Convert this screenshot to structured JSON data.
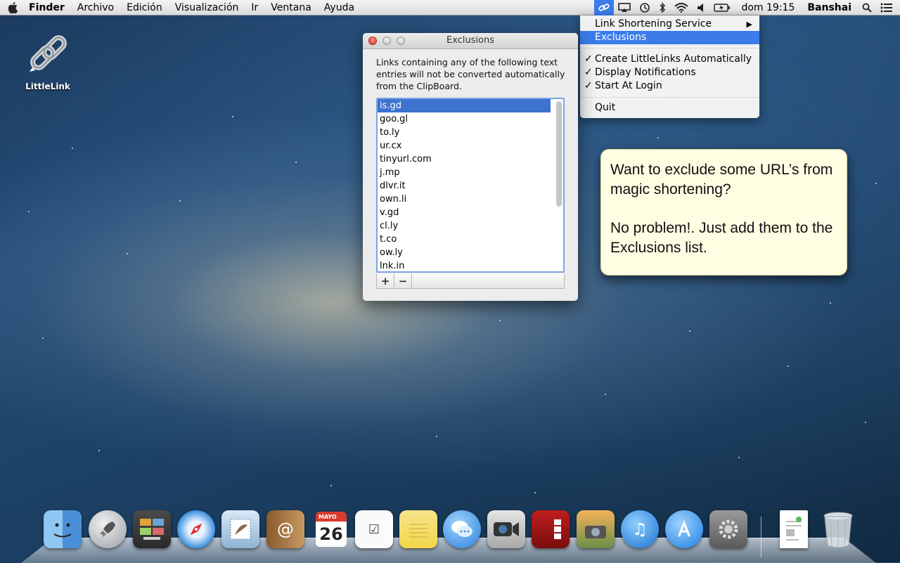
{
  "menubar": {
    "apple_icon": "apple-icon",
    "app_name": "Finder",
    "menus": [
      "Archivo",
      "Edición",
      "Visualización",
      "Ir",
      "Ventana",
      "Ayuda"
    ],
    "clock": "dom 19:15",
    "user": "Banshai",
    "status_icons": [
      "littlelink-icon",
      "airplay-icon",
      "time-machine-icon",
      "bluetooth-icon",
      "wifi-icon",
      "volume-icon",
      "battery-icon",
      "spotlight-icon",
      "notification-center-icon"
    ]
  },
  "status_menu": {
    "items": [
      {
        "label": "Link Shortening Service",
        "submenu": true
      },
      {
        "label": "Exclusions",
        "highlighted": true
      },
      {
        "label": "Create LittleLinks Automatically",
        "checked": true
      },
      {
        "label": "Display Notifications",
        "checked": true
      },
      {
        "label": "Start At Login",
        "checked": true
      },
      {
        "label": "Quit"
      }
    ],
    "check_glyph": "✓",
    "arrow_glyph": "▶"
  },
  "desktop": {
    "icon_label": "LittleLink"
  },
  "window": {
    "title": "Exclusions",
    "description": "Links containing any of the following text entries will not be converted automatically from the ClipBoard.",
    "entries": [
      "is.gd",
      "goo.gl",
      "to.ly",
      "ur.cx",
      "tinyurl.com",
      "j.mp",
      "dlvr.it",
      "own.li",
      "v.gd",
      "cl.ly",
      "t.co",
      "ow.ly",
      "lnk.in"
    ],
    "selected_index": 0,
    "add_label": "+",
    "remove_label": "−"
  },
  "note": {
    "line1": "Want to exclude some URL’s from magic shortening?",
    "line2": "No problem!.  Just add them to the Exclusions list."
  },
  "dock": {
    "calendar_month": "MAYO",
    "calendar_day": "26",
    "items": [
      "finder-icon",
      "launchpad-icon",
      "mission-control-icon",
      "safari-icon",
      "mail-icon",
      "contacts-icon",
      "calendar-icon",
      "reminders-icon",
      "notes-icon",
      "messages-icon",
      "facetime-icon",
      "photo-booth-icon",
      "iphoto-icon",
      "itunes-icon",
      "app-store-icon",
      "system-preferences-icon",
      "document-icon",
      "trash-icon"
    ]
  },
  "colors": {
    "selection": "#3b7bea",
    "list_selection": "#3d72cf",
    "note_bg": "#fffde2",
    "desktop": "#1d4268"
  }
}
